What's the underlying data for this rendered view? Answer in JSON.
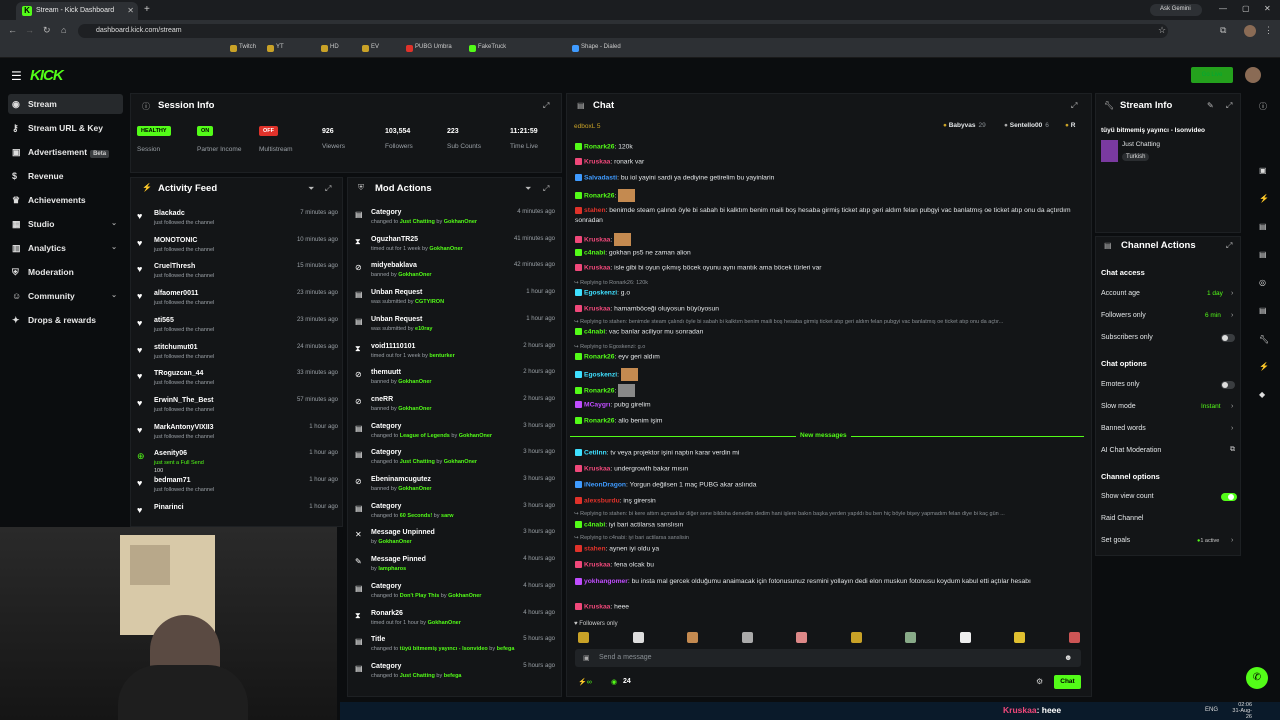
{
  "browser": {
    "tab_title": "Stream - Kick Dashboard",
    "url": "dashboard.kick.com/stream",
    "ask_gemini": "Ask Gemini",
    "bookmarks": [
      "Twitch",
      "YT",
      "HD",
      "EV",
      "PUBG Umbra",
      "FakeTruck",
      "Shape - Dialed"
    ]
  },
  "kick": {
    "logo": "KICK",
    "go_live": "Go Live"
  },
  "sidebar": {
    "items": [
      {
        "label": "Stream",
        "icon": "broadcast-icon",
        "active": true
      },
      {
        "label": "Stream URL & Key",
        "icon": "key-icon"
      },
      {
        "label": "Advertisement",
        "icon": "ad-icon",
        "badge": "Beta"
      },
      {
        "label": "Revenue",
        "icon": "dollar-icon"
      },
      {
        "label": "Achievements",
        "icon": "trophy-icon"
      },
      {
        "label": "Studio",
        "icon": "studio-icon",
        "chevron": true
      },
      {
        "label": "Analytics",
        "icon": "chart-icon",
        "chevron": true
      },
      {
        "label": "Moderation",
        "icon": "shield-icon"
      },
      {
        "label": "Community",
        "icon": "users-icon",
        "chevron": true
      },
      {
        "label": "Drops & rewards",
        "icon": "gift-icon"
      }
    ]
  },
  "session": {
    "title": "Session Info",
    "stats": [
      {
        "value": "HEALTHY",
        "label": "Session",
        "type": "badge",
        "color": "#53fc18"
      },
      {
        "value": "ON",
        "label": "Partner Income",
        "type": "badge",
        "color": "#53fc18"
      },
      {
        "value": "OFF",
        "label": "Multistream",
        "type": "badge",
        "color": "#e0322a"
      },
      {
        "value": "926",
        "label": "Viewers"
      },
      {
        "value": "103,554",
        "label": "Followers"
      },
      {
        "value": "223",
        "label": "Sub Counts"
      },
      {
        "value": "11:21:59",
        "label": "Time Live"
      }
    ]
  },
  "activity": {
    "title": "Activity Feed",
    "items": [
      {
        "name": "Blackadc",
        "sub": "just followed the channel",
        "time": "7 minutes ago"
      },
      {
        "name": "MONOTONIC",
        "sub": "just followed the channel",
        "time": "10 minutes ago"
      },
      {
        "name": "CruelThresh",
        "sub": "just followed the channel",
        "time": "15 minutes ago"
      },
      {
        "name": "alfaomer0011",
        "sub": "just followed the channel",
        "time": "23 minutes ago"
      },
      {
        "name": "ati565",
        "sub": "just followed the channel",
        "time": "23 minutes ago"
      },
      {
        "name": "stitchumut01",
        "sub": "just followed the channel",
        "time": "24 minutes ago"
      },
      {
        "name": "TRoguzcan_44",
        "sub": "just followed the channel",
        "time": "33 minutes ago"
      },
      {
        "name": "ErwinN_The_Best",
        "sub": "just followed the channel",
        "time": "57 minutes ago"
      },
      {
        "name": "MarkAntonyVIXII3",
        "sub": "just followed the channel",
        "time": "1 hour ago"
      },
      {
        "name": "Asenity06",
        "sub": "just sent a Full Send",
        "time": "1 hour ago",
        "extra": "100"
      },
      {
        "name": "bedmam71",
        "sub": "just followed the channel",
        "time": "1 hour ago"
      },
      {
        "name": "Pinarinci",
        "sub": "",
        "time": "1 hour ago"
      }
    ]
  },
  "mod": {
    "title": "Mod Actions",
    "items": [
      {
        "title": "Category",
        "pre": "changed to ",
        "hl": "Just Chatting",
        "mid": " by ",
        "by": "GokhanOner",
        "time": "4 minutes ago",
        "icon": "category-icon"
      },
      {
        "title": "OguzhanTR25",
        "pre": "timed out for 1 week by ",
        "hl": "",
        "mid": "",
        "by": "GokhanOner",
        "time": "41 minutes ago",
        "icon": "hourglass-icon"
      },
      {
        "title": "midyebaklava",
        "pre": "banned by ",
        "hl": "",
        "mid": "",
        "by": "GokhanOner",
        "time": "42 minutes ago",
        "icon": "ban-icon"
      },
      {
        "title": "Unban Request",
        "pre": "was submitted by ",
        "hl": "",
        "mid": "",
        "by": "CGTYIRON",
        "time": "1 hour ago",
        "icon": "request-icon"
      },
      {
        "title": "Unban Request",
        "pre": "was submitted by ",
        "hl": "",
        "mid": "",
        "by": "e10ray",
        "time": "1 hour ago",
        "icon": "request-icon"
      },
      {
        "title": "void11110101",
        "pre": "timed out for 1 week by ",
        "hl": "",
        "mid": "",
        "by": "benturker",
        "time": "2 hours ago",
        "icon": "hourglass-icon"
      },
      {
        "title": "themuutt",
        "pre": "banned by ",
        "hl": "",
        "mid": "",
        "by": "GokhanOner",
        "time": "2 hours ago",
        "icon": "ban-icon"
      },
      {
        "title": "cneRR",
        "pre": "banned by ",
        "hl": "",
        "mid": "",
        "by": "GokhanOner",
        "time": "2 hours ago",
        "icon": "ban-icon"
      },
      {
        "title": "Category",
        "pre": "changed to ",
        "hl": "League of Legends",
        "mid": " by ",
        "by": "GokhanOner",
        "time": "3 hours ago",
        "icon": "category-icon"
      },
      {
        "title": "Category",
        "pre": "changed to ",
        "hl": "Just Chatting",
        "mid": " by ",
        "by": "GokhanOner",
        "time": "3 hours ago",
        "icon": "category-icon"
      },
      {
        "title": "Ebeninamcugutez",
        "pre": "banned by ",
        "hl": "",
        "mid": "",
        "by": "GokhanOner",
        "time": "3 hours ago",
        "icon": "ban-icon"
      },
      {
        "title": "Category",
        "pre": "changed to ",
        "hl": "60 Seconds!",
        "mid": " by ",
        "by": "sarw",
        "time": "3 hours ago",
        "icon": "category-icon"
      },
      {
        "title": "Message Unpinned",
        "pre": "by ",
        "hl": "",
        "mid": "",
        "by": "GokhanOner",
        "time": "3 hours ago",
        "icon": "unpin-icon"
      },
      {
        "title": "Message Pinned",
        "pre": "by ",
        "hl": "",
        "mid": "",
        "by": "lampharos",
        "time": "4 hours ago",
        "icon": "pin-icon"
      },
      {
        "title": "Category",
        "pre": "changed to ",
        "hl": "Don't Play This",
        "mid": " by ",
        "by": "GokhanOner",
        "time": "4 hours ago",
        "icon": "category-icon"
      },
      {
        "title": "Ronark26",
        "pre": "timed out for 1 hour by ",
        "hl": "",
        "mid": "",
        "by": "GokhanOner",
        "time": "4 hours ago",
        "icon": "hourglass-icon"
      },
      {
        "title": "Title",
        "pre": "changed to ",
        "hl": "tüyü bitmemiş yayıncı - Isonvideo",
        "mid": " by ",
        "by": "befega",
        "time": "5 hours ago",
        "icon": "title-icon"
      },
      {
        "title": "Category",
        "pre": "changed to ",
        "hl": "Just Chatting",
        "mid": " by ",
        "by": "befega",
        "time": "5 hours ago",
        "icon": "category-icon"
      }
    ]
  },
  "chat": {
    "title": "Chat",
    "pinned_left": "edboxL 5",
    "top_users": [
      {
        "name": "Babyvas",
        "n": "29"
      },
      {
        "name": "Sentello00",
        "n": "6"
      },
      {
        "name": "R",
        "n": ""
      }
    ],
    "messages": [
      {
        "user": "Ronark26",
        "color": "#53fc18",
        "text": "120k"
      },
      {
        "user": "Kruskaa",
        "color": "#f0487a",
        "text": "ronark var"
      },
      {
        "user": "Salvadasti",
        "color": "#3f9bff",
        "text": "bu iol yayini sardi ya dediyine getirelim bu yayinlarin"
      },
      {
        "user": "Ronark26",
        "color": "#53fc18",
        "text": ""
      },
      {
        "user": "stahen",
        "color": "#e0322a",
        "text": "benimde steam çalındı öyle bi sabah bi kalktım benim maili boş hesaba girmiş ticket atıp geri aldım felan pubgyi vac banlatmış oe ticket atıp onu da açtırdım sonradan"
      },
      {
        "user": "Kruskaa",
        "color": "#f0487a",
        "text": ""
      },
      {
        "user": "c4nabi",
        "color": "#53fc18",
        "text": "gokhan ps5 ne zaman alion"
      },
      {
        "user": "Kruskaa",
        "color": "#f0487a",
        "text": "isle gibi bi oyun çıkmış böcek oyunu aynı mantık ama böcek türleri var"
      },
      {
        "reply": "Replying to Ronark26: 120k"
      },
      {
        "user": "Egoskenzi",
        "color": "#3fe0ff",
        "text": "g.o"
      },
      {
        "user": "Kruskaa",
        "color": "#f0487a",
        "text": "hamamböceği oluyosun büyüyosun"
      },
      {
        "reply": "Replying to stahen: benimde steam çalındı öyle bi sabah bi kalktım benim maili boş hesaba girmiş ticket atıp geri aldım felan pubgyi vac banlatmış oe ticket atıp onu da açtır..."
      },
      {
        "user": "c4nabi",
        "color": "#53fc18",
        "text": "vac banlar aciliyor mu sonradan"
      },
      {
        "reply": "Replying to Egoskenzi: g.o"
      },
      {
        "user": "Ronark26",
        "color": "#53fc18",
        "text": "eyv geri aldım"
      },
      {
        "user": "Egoskenzi",
        "color": "#3fe0ff",
        "text": ""
      },
      {
        "user": "Ronark26",
        "color": "#53fc18",
        "text": ""
      },
      {
        "user": "MCaygrı",
        "color": "#c04dff",
        "text": "pubg girelim"
      },
      {
        "user": "Ronark26",
        "color": "#53fc18",
        "text": "allo benim işim"
      }
    ],
    "new_messages": "New messages",
    "messages2": [
      {
        "user": "Cetilnn",
        "color": "#3fe0ff",
        "text": "tv veya projektor işini naptın karar verdin mi"
      },
      {
        "user": "Kruskaa",
        "color": "#f0487a",
        "text": "undergrowth bakar mısın"
      },
      {
        "user": "iNeonDragon",
        "color": "#3f9bff",
        "text": "Yorgun değilsen 1 maç PUBG akar aslında"
      },
      {
        "user": "alexsburdu",
        "color": "#e0322a",
        "text": "inş girersin"
      },
      {
        "reply": "Replying to stahen: bi kere attım açmadılar diğer sene bildsha denedim dedim hani işlere bakın başka yerden yapıldı bu ben hiç böyle bişey yapmadım felan diye bi kaç gün ..."
      },
      {
        "user": "c4nabi",
        "color": "#53fc18",
        "text": "iyi bari actilarsa sanslısın"
      },
      {
        "reply": "Replying to c4nabi: iyi bari actilarsa sanslisin"
      },
      {
        "user": "stahen",
        "color": "#e0322a",
        "text": "aynen iyi oldu ya"
      },
      {
        "user": "Kruskaa",
        "color": "#f0487a",
        "text": "fena olcak bu"
      },
      {
        "user": "yokhangomer",
        "color": "#c04dff",
        "text": "bu insta mal gercek olduğumu anaimacak için fotonusunuz resmini yollayın dedi elon muskun fotonusu koydum kabul etti açtılar hesabı"
      },
      {
        "user": "Kruskaa",
        "color": "#f0487a",
        "text": "heee"
      }
    ],
    "followers_only": "Followers only",
    "input_placeholder": "Send a message",
    "viewer_count": "24",
    "send_label": "Chat"
  },
  "stream_info": {
    "title": "Stream Info",
    "stream_title": "tüyü bitmemiş yayıncı - Isonvideo",
    "category": "Just Chatting",
    "tag": "Turkish"
  },
  "channel_actions": {
    "title": "Channel Actions",
    "chat_access": "Chat access",
    "account_age": "Account age",
    "account_age_val": "1 day",
    "followers_only": "Followers only",
    "followers_only_val": "6 min",
    "subscribers_only": "Subscribers only",
    "chat_options": "Chat options",
    "emotes_only": "Emotes only",
    "slow_mode": "Slow mode",
    "slow_mode_val": "Instant",
    "banned_words": "Banned words",
    "ai_mod": "AI Chat Moderation",
    "channel_options": "Channel options",
    "show_view_count": "Show view count",
    "raid": "Raid Channel",
    "set_goals": "Set goals",
    "set_goals_val": "1 active"
  },
  "taskbar": {
    "overlay_user": "Kruskaa",
    "overlay_text": ": heee",
    "lang": "ENG",
    "time": "02:06",
    "date": "31-Aug-26"
  }
}
